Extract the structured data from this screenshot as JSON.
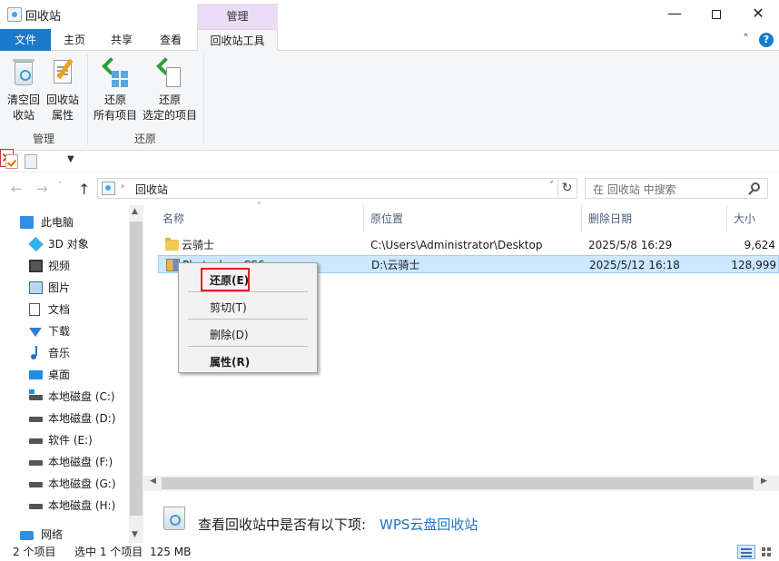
{
  "window": {
    "title": "回收站",
    "context_label": "管理",
    "minimize": "—",
    "close": "✕"
  },
  "tabs": {
    "file": "文件",
    "home": "主页",
    "share": "共享",
    "view": "查看",
    "tools": "回收站工具"
  },
  "ribbon": {
    "empty_bin_l1": "清空回",
    "empty_bin_l2": "收站",
    "props_l1": "回收站",
    "props_l2": "属性",
    "restore_all_l1": "还原",
    "restore_all_l2": "所有项目",
    "restore_sel_l1": "还原",
    "restore_sel_l2": "选定的项目",
    "group_manage": "管理",
    "group_restore": "还原"
  },
  "address": {
    "path": "回收站",
    "search_placeholder": "在 回收站 中搜索"
  },
  "nav_pane": {
    "items": [
      {
        "label": "此电脑",
        "icon": "computer-icon"
      },
      {
        "label": "3D 对象",
        "icon": "3d-objects-icon"
      },
      {
        "label": "视频",
        "icon": "video-icon"
      },
      {
        "label": "图片",
        "icon": "pictures-icon"
      },
      {
        "label": "文档",
        "icon": "documents-icon"
      },
      {
        "label": "下载",
        "icon": "download-icon"
      },
      {
        "label": "音乐",
        "icon": "music-icon"
      },
      {
        "label": "桌面",
        "icon": "desktop-icon"
      },
      {
        "label": "本地磁盘 (C:)",
        "icon": "drive-icon"
      },
      {
        "label": "本地磁盘 (D:)",
        "icon": "drive-icon"
      },
      {
        "label": "软件 (E:)",
        "icon": "drive-icon"
      },
      {
        "label": "本地磁盘 (F:)",
        "icon": "drive-icon"
      },
      {
        "label": "本地磁盘 (G:)",
        "icon": "drive-icon"
      },
      {
        "label": "本地磁盘 (H:)",
        "icon": "drive-icon"
      },
      {
        "label": "网络",
        "icon": "network-icon"
      }
    ]
  },
  "columns": {
    "name": "名称",
    "original_location": "原位置",
    "date_deleted": "删除日期",
    "size": "大小"
  },
  "files": [
    {
      "name": "云骑士",
      "location": "C:\\Users\\Administrator\\Desktop",
      "date": "2025/5/8 16:29",
      "size": "9,624",
      "selected": false
    },
    {
      "name": "Photoshop CS6",
      "location": "D:\\云骑士",
      "date": "2025/5/12 16:18",
      "size": "128,999",
      "selected": true
    }
  ],
  "context_menu": {
    "restore": "还原(E)",
    "cut": "剪切(T)",
    "delete": "删除(D)",
    "properties": "属性(R)"
  },
  "info_bar": {
    "text": "查看回收站中是否有以下项:",
    "link": "WPS云盘回收站"
  },
  "status": {
    "count": "2 个项目",
    "selected": "选中 1 个项目",
    "size": "125 MB"
  }
}
